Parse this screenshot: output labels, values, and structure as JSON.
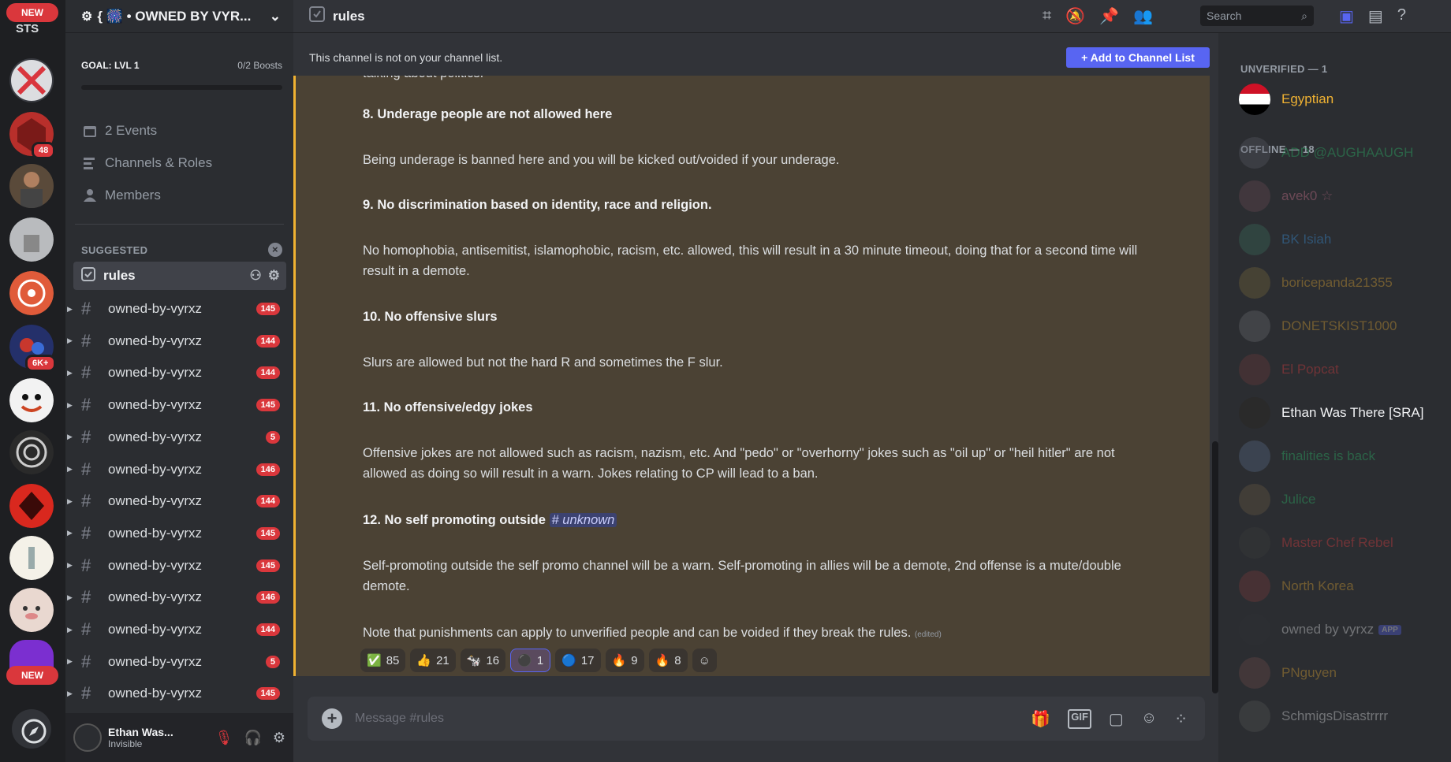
{
  "rail": {
    "top_badge": "NEW",
    "top_label": "STS",
    "mid_badges": [
      "48",
      "6K+"
    ],
    "bottom_badge": "NEW"
  },
  "guild": {
    "name": "{ 🎆 • OWNED BY VYR...",
    "goal_label": "GOAL: LVL 1",
    "goal_boosts": "0/2 Boosts",
    "goal_progress": 0
  },
  "sidebar_nav": [
    {
      "label": "2 Events",
      "icon": "calendar-icon"
    },
    {
      "label": "Channels & Roles",
      "icon": "channels-roles-icon"
    },
    {
      "label": "Members",
      "icon": "members-icon"
    }
  ],
  "suggested_label": "SUGGESTED",
  "active_channel": "rules",
  "channels": [
    {
      "name": "owned-by-vyrxz",
      "badge": "145"
    },
    {
      "name": "owned-by-vyrxz",
      "badge": "144"
    },
    {
      "name": "owned-by-vyrxz",
      "badge": "144"
    },
    {
      "name": "owned-by-vyrxz",
      "badge": "145"
    },
    {
      "name": "owned-by-vyrxz",
      "badge": "5"
    },
    {
      "name": "owned-by-vyrxz",
      "badge": "146"
    },
    {
      "name": "owned-by-vyrxz",
      "badge": "144"
    },
    {
      "name": "owned-by-vyrxz",
      "badge": "145"
    },
    {
      "name": "owned-by-vyrxz",
      "badge": "145"
    },
    {
      "name": "owned-by-vyrxz",
      "badge": "146"
    },
    {
      "name": "owned-by-vyrxz",
      "badge": "144"
    },
    {
      "name": "owned-by-vyrxz",
      "badge": "5"
    },
    {
      "name": "owned-by-vyrxz",
      "badge": "145"
    }
  ],
  "user": {
    "name": "Ethan Was...",
    "status": "Invisible"
  },
  "topbar": {
    "channel": "rules",
    "search_placeholder": "Search"
  },
  "notice": {
    "text": "This channel is not on your channel list.",
    "button": "+ Add to Channel List"
  },
  "messages": [
    {
      "text": "talking about politics.",
      "bold": false
    },
    {
      "text": "8. Underage people are not allowed here",
      "bold": true
    },
    {
      "text": "Being underage is banned here and you will be kicked out/voided if your underage.",
      "bold": false
    },
    {
      "text": "9. No discrimination based on identity, race and religion.",
      "bold": true
    },
    {
      "text": "No homophobia, antisemitist, islamophobic, racism, etc. allowed, this will result in a 30 minute timeout, doing that for a second time will result in a demote.",
      "bold": false
    },
    {
      "text": "10. No offensive slurs",
      "bold": true
    },
    {
      "text": "Slurs are allowed but not the hard R and sometimes the F slur.",
      "bold": false
    },
    {
      "text": "11. No offensive/edgy jokes",
      "bold": true
    },
    {
      "text": "Offensive jokes are not allowed such as racism, nazism, etc. And \"pedo\" or \"overhorny\" jokes such as \"oil up\" or \"heil hitler\" are not allowed as doing so will result in a warn. Jokes relating to CP will lead to a ban.",
      "bold": false
    },
    {
      "text": "12. No self promoting outside",
      "bold": true,
      "mention": "# unknown"
    },
    {
      "text": "Self-promoting outside the self promo channel will be a warn. Self-promoting in allies will be a demote, 2nd offense is a mute/double demote.",
      "bold": false
    },
    {
      "text": "Note that punishments can apply to unverified people and can be voided if they break the rules.",
      "bold": false,
      "edited": "(edited)"
    }
  ],
  "reactions": [
    {
      "emoji": "✅",
      "count": "85"
    },
    {
      "emoji": "👍",
      "count": "21"
    },
    {
      "emoji": "🐄",
      "count": "16"
    },
    {
      "emoji": "⚫",
      "count": "1"
    },
    {
      "emoji": "🔵",
      "count": "17"
    },
    {
      "emoji": "🔥",
      "count": "9"
    },
    {
      "emoji": "🔥",
      "count": "8"
    }
  ],
  "composer": {
    "placeholder": "Message #rules"
  },
  "members": {
    "unverified_header": "UNVERIFIED — 1",
    "unverified": [
      {
        "name": "Egyptian",
        "color": "#f0b232"
      }
    ],
    "offline_header": "OFFLINE — 18",
    "offline": [
      {
        "name": "ADD @AUGHAAUGH",
        "color": "#2dc770"
      },
      {
        "name": "avek0 ☆",
        "color": "#e67e9b"
      },
      {
        "name": "BK Isiah",
        "color": "#3ba1f5"
      },
      {
        "name": "boricepanda21355",
        "color": "#f0b232"
      },
      {
        "name": "DONETSKIST1000",
        "color": "#f0b232"
      },
      {
        "name": "El Popcat",
        "color": "#f23f42"
      },
      {
        "name": "Ethan Was There [SRA]",
        "color": "#f2f3f5"
      },
      {
        "name": "finalities is back",
        "color": "#2dc770"
      },
      {
        "name": "Julice",
        "color": "#2dc770"
      },
      {
        "name": "Master Chef Rebel",
        "color": "#f23f42"
      },
      {
        "name": "North Korea",
        "color": "#f0b232"
      },
      {
        "name": "owned by vyrxz",
        "color": "#f2f3f5",
        "badge": "APP"
      },
      {
        "name": "PNguyen",
        "color": "#f0b232"
      },
      {
        "name": "SchmigsDisastrrrr",
        "color": "#f2f3f5"
      }
    ]
  }
}
